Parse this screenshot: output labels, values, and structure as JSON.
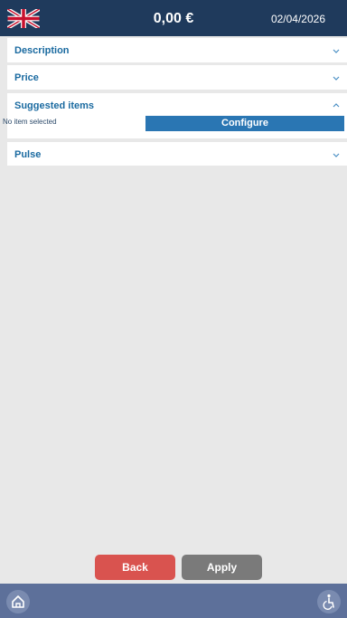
{
  "header": {
    "language_icon": "uk-flag-icon",
    "total": "0,00 €",
    "date": "02/04/2026"
  },
  "sections": {
    "description": {
      "title": "Description",
      "state": "collapsed"
    },
    "price": {
      "title": "Price",
      "state": "collapsed"
    },
    "suggested": {
      "title": "Suggested items",
      "state": "expanded",
      "no_item": "No item selected",
      "configure_label": "Configure"
    },
    "pulse": {
      "title": "Pulse",
      "state": "collapsed"
    }
  },
  "footer": {
    "back_label": "Back",
    "apply_label": "Apply",
    "home_icon": "home-icon",
    "accessibility_icon": "accessibility-icon"
  },
  "colors": {
    "header_bg": "#1f3a5c",
    "section_title": "#1a6aa0",
    "configure": "#2a76b3",
    "back": "#d9534f",
    "apply": "#7a7a7a",
    "bottombar": "#5d709a"
  }
}
